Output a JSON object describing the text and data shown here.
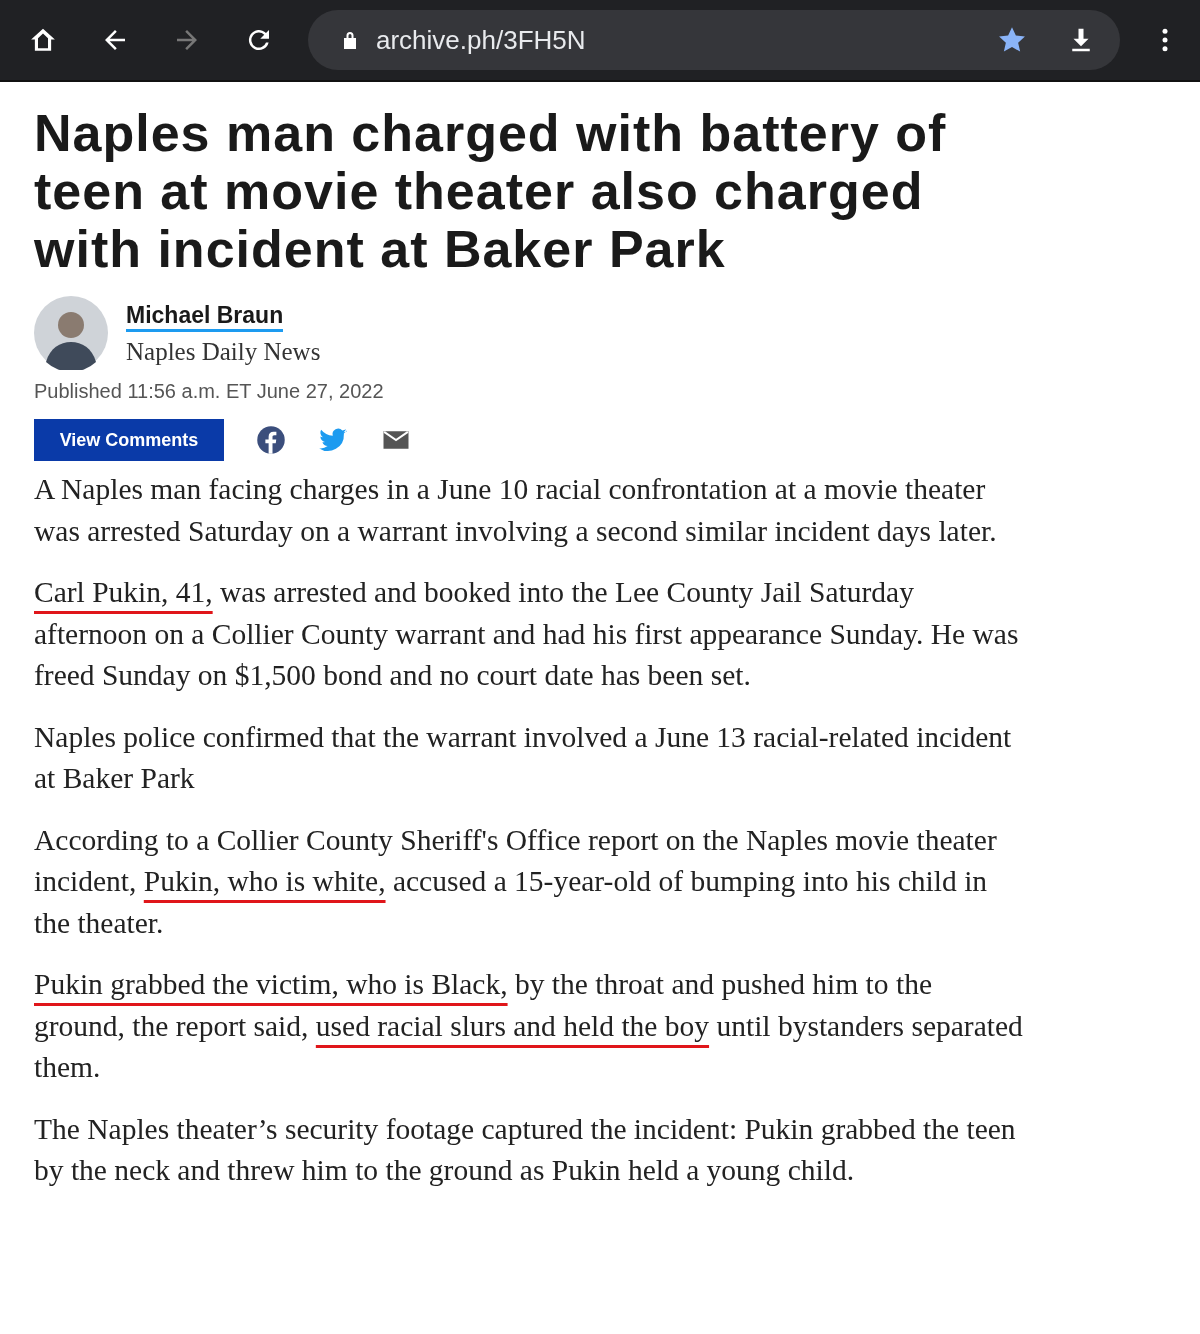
{
  "browser": {
    "url": "archive.ph/3FH5N",
    "forward_disabled": true,
    "bookmarked": true
  },
  "article": {
    "headline": "Naples man charged with battery of teen at movie theater also charged with incident at Baker Park",
    "author": "Michael Braun",
    "outlet": "Naples Daily News",
    "published": "Published 11:56 a.m. ET June 27, 2022",
    "comments_button": "View Comments",
    "paragraphs": [
      {
        "segments": [
          {
            "text": "A Naples man facing charges in a June 10 racial confrontation at a movie theater was arrested Saturday on a warrant involving a second similar incident days later.",
            "underlined": false
          }
        ]
      },
      {
        "segments": [
          {
            "text": "Carl Pukin, 41,",
            "underlined": true
          },
          {
            "text": " was arrested and booked into the Lee County Jail Saturday afternoon on a Collier County warrant and had his first appearance Sunday. He was freed Sunday on $1,500 bond and no court date has been set.",
            "underlined": false
          }
        ]
      },
      {
        "segments": [
          {
            "text": "Naples police confirmed that the warrant involved a June 13 racial-related incident at Baker Park",
            "underlined": false
          }
        ]
      },
      {
        "segments": [
          {
            "text": "According to a Collier County Sheriff's Office report on the Naples movie theater incident, ",
            "underlined": false
          },
          {
            "text": "Pukin, who is white,",
            "underlined": true
          },
          {
            "text": " accused a 15-year-old of bumping into his child in the theater.",
            "underlined": false
          }
        ]
      },
      {
        "segments": [
          {
            "text": "Pukin grabbed the victim, who is Black,",
            "underlined": true
          },
          {
            "text": " by the throat and pushed him to the ground, the report said, ",
            "underlined": false
          },
          {
            "text": "used racial slurs and held the boy",
            "underlined": true
          },
          {
            "text": " until bystanders separated them.",
            "underlined": false
          }
        ]
      },
      {
        "segments": [
          {
            "text": "The Naples theater’s security footage captured the incident: Pukin grabbed the teen by the neck and threw him to the ground as Pukin held a young child.",
            "underlined": false
          }
        ]
      }
    ]
  }
}
